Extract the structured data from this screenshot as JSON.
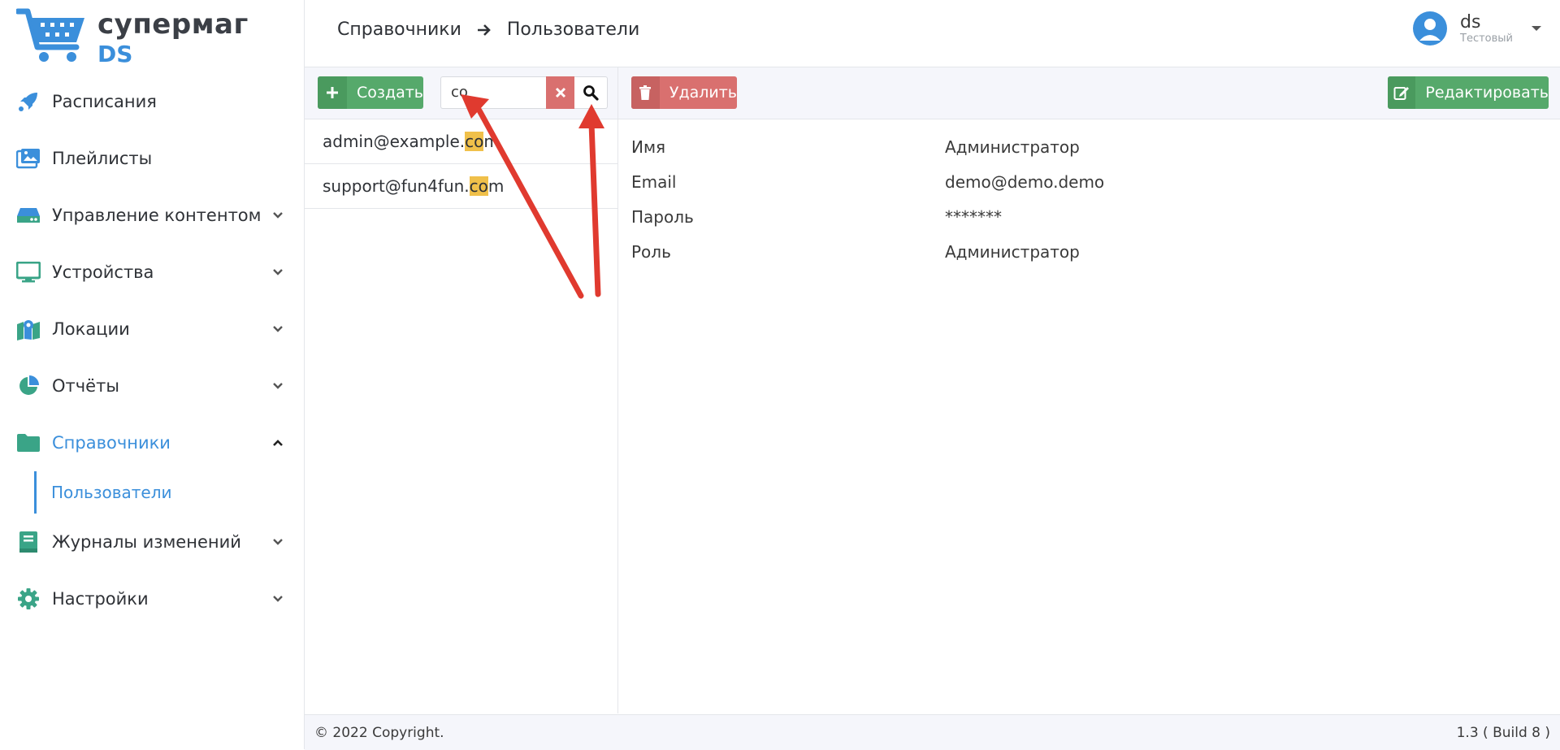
{
  "app": {
    "logo_line1": "супермаг",
    "logo_line2": "DS"
  },
  "sidebar": {
    "items": [
      {
        "label": "Расписания",
        "icon": "rocket-icon",
        "has_chevron": false
      },
      {
        "label": "Плейлисты",
        "icon": "images-icon",
        "has_chevron": false
      },
      {
        "label": "Управление контентом",
        "icon": "hdd-icon",
        "has_chevron": true
      },
      {
        "label": "Устройства",
        "icon": "monitor-icon",
        "has_chevron": true
      },
      {
        "label": "Локации",
        "icon": "map-icon",
        "has_chevron": true
      },
      {
        "label": "Отчёты",
        "icon": "pie-chart-icon",
        "has_chevron": true
      },
      {
        "label": "Справочники",
        "icon": "folder-icon",
        "has_chevron": true,
        "expanded": true
      },
      {
        "label": "Журналы изменений",
        "icon": "book-icon",
        "has_chevron": true
      },
      {
        "label": "Настройки",
        "icon": "gear-icon",
        "has_chevron": true
      }
    ],
    "subitems": [
      {
        "label": "Пользователи"
      }
    ]
  },
  "header": {
    "breadcrumb": [
      "Справочники",
      "Пользователи"
    ],
    "user_name": "ds",
    "user_role": "Тестовый"
  },
  "list": {
    "create_label": "Создать",
    "search_value": "co",
    "items": [
      {
        "before": "admin@example.",
        "match": "co",
        "after": "m"
      },
      {
        "before": "support@fun4fun.",
        "match": "co",
        "after": "m"
      }
    ]
  },
  "detail": {
    "delete_label": "Удалить",
    "edit_label": "Редактировать",
    "fields": [
      {
        "label": "Имя",
        "value": "Администратор"
      },
      {
        "label": "Email",
        "value": "demo@demo.demo"
      },
      {
        "label": "Пароль",
        "value": "*******"
      },
      {
        "label": "Роль",
        "value": "Администратор"
      }
    ]
  },
  "footer": {
    "copyright": "© 2022 Copyright.",
    "version": "1.3 ( Build 8 )"
  },
  "colors": {
    "accent": "#3b8fdb",
    "success": "#56a96b",
    "danger": "#d9706f",
    "highlight": "#f0c04a",
    "nav_icon": "#3aa487",
    "annotation": "#e03a2f"
  }
}
